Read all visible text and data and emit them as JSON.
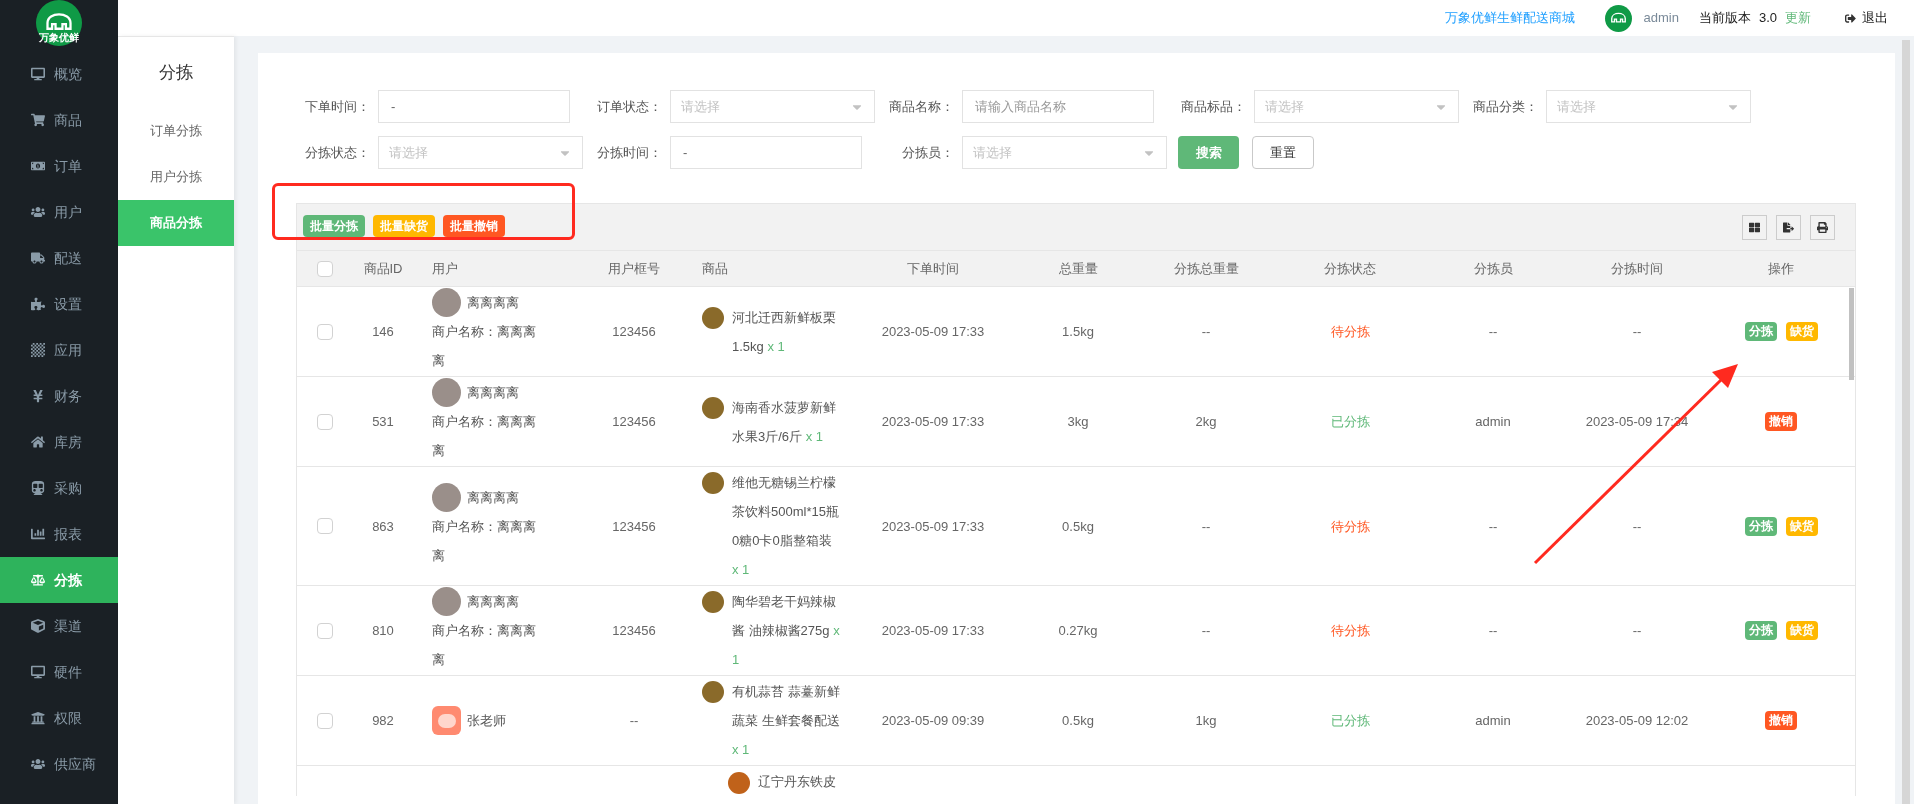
{
  "logo": {
    "text": "万象优鲜"
  },
  "top_bar": {
    "shop_link": "万象优鲜生鲜配送商城",
    "username": "admin",
    "version_label": "当前版本",
    "version": "3.0",
    "update": "更新",
    "logout": "退出"
  },
  "sidebar": {
    "items": [
      {
        "label": "概览",
        "selected": false
      },
      {
        "label": "商品",
        "selected": false
      },
      {
        "label": "订单",
        "selected": false
      },
      {
        "label": "用户",
        "selected": false
      },
      {
        "label": "配送",
        "selected": false
      },
      {
        "label": "设置",
        "selected": false
      },
      {
        "label": "应用",
        "selected": false
      },
      {
        "label": "财务",
        "selected": false
      },
      {
        "label": "库房",
        "selected": false
      },
      {
        "label": "采购",
        "selected": false
      },
      {
        "label": "报表",
        "selected": false
      },
      {
        "label": "分拣",
        "selected": true
      },
      {
        "label": "渠道",
        "selected": false
      },
      {
        "label": "硬件",
        "selected": false
      },
      {
        "label": "权限",
        "selected": false
      },
      {
        "label": "供应商",
        "selected": false
      }
    ]
  },
  "subnav": {
    "title": "分拣",
    "items": [
      {
        "label": "订单分拣",
        "selected": false
      },
      {
        "label": "用户分拣",
        "selected": false
      },
      {
        "label": "商品分拣",
        "selected": true
      }
    ]
  },
  "filters": [
    {
      "kind": "text",
      "label": "下单时间：",
      "value": "-"
    },
    {
      "kind": "select",
      "label": "订单状态：",
      "placeholder": "请选择"
    },
    {
      "kind": "text",
      "label": "商品名称：",
      "placeholder": "请输入商品名称"
    },
    {
      "kind": "select",
      "label": "商品标品：",
      "placeholder": "请选择"
    },
    {
      "kind": "select",
      "label": "商品分类：",
      "placeholder": "请选择"
    },
    {
      "kind": "select",
      "label": "分拣状态：",
      "placeholder": "请选择"
    },
    {
      "kind": "text",
      "label": "分拣时间：",
      "value": "-"
    },
    {
      "kind": "select",
      "label": "分拣员：",
      "placeholder": "请选择"
    }
  ],
  "search_button": "搜索",
  "reset_button": "重置",
  "batch_actions": [
    {
      "label": "批量分拣",
      "color": "#5fb878"
    },
    {
      "label": "批量缺货",
      "color": "#ffb800"
    },
    {
      "label": "批量撤销",
      "color": "#ff5722"
    }
  ],
  "table": {
    "all_checked": false,
    "columns": [
      "商品ID",
      "用户",
      "用户框号",
      "商品",
      "下单时间",
      "总重量",
      "分拣总重量",
      "分拣状态",
      "分拣员",
      "分拣时间",
      "操作"
    ],
    "rows": [
      {
        "checked": false,
        "id": "146",
        "user": {
          "kind": "photo",
          "name": "离离离离",
          "merchant": "商户名称：离离离离"
        },
        "box_no": "123456",
        "product": {
          "name": "河北迁西新鲜板栗1.5kg",
          "qty": "x 1"
        },
        "order_time": "2023-05-09 17:33",
        "total_weight": "1.5kg",
        "sorted_weight": "--",
        "status": {
          "kind": "pending",
          "label": "待分拣"
        },
        "sorter": "--",
        "sort_time": "--",
        "actions": [
          {
            "label": "分拣",
            "color": "#5fb878"
          },
          {
            "label": "缺货",
            "color": "#ffb800"
          }
        ]
      },
      {
        "checked": false,
        "id": "531",
        "user": {
          "kind": "photo",
          "name": "离离离离",
          "merchant": "商户名称：离离离离"
        },
        "box_no": "123456",
        "product": {
          "name": "海南香水菠萝新鲜水果3斤/6斤",
          "qty": "x 1"
        },
        "order_time": "2023-05-09 17:33",
        "total_weight": "3kg",
        "sorted_weight": "2kg",
        "status": {
          "kind": "done",
          "label": "已分拣"
        },
        "sorter": "admin",
        "sort_time": "2023-05-09 17:34",
        "actions": [
          {
            "label": "撤销",
            "color": "#ff5722"
          }
        ]
      },
      {
        "checked": false,
        "id": "863",
        "user": {
          "kind": "photo",
          "name": "离离离离",
          "merchant": "商户名称：离离离离"
        },
        "box_no": "123456",
        "product": {
          "name": "维他无糖锡兰柠檬茶饮料500ml*15瓶 0糖0卡0脂整箱装",
          "qty": "x 1"
        },
        "order_time": "2023-05-09 17:33",
        "total_weight": "0.5kg",
        "sorted_weight": "--",
        "status": {
          "kind": "pending",
          "label": "待分拣"
        },
        "sorter": "--",
        "sort_time": "--",
        "actions": [
          {
            "label": "分拣",
            "color": "#5fb878"
          },
          {
            "label": "缺货",
            "color": "#ffb800"
          }
        ]
      },
      {
        "checked": false,
        "id": "810",
        "user": {
          "kind": "photo",
          "name": "离离离离",
          "merchant": "商户名称：离离离离"
        },
        "box_no": "123456",
        "product": {
          "name": "陶华碧老干妈辣椒酱 油辣椒酱275g",
          "qty": "x 1"
        },
        "order_time": "2023-05-09 17:33",
        "total_weight": "0.27kg",
        "sorted_weight": "--",
        "status": {
          "kind": "pending",
          "label": "待分拣"
        },
        "sorter": "--",
        "sort_time": "--",
        "actions": [
          {
            "label": "分拣",
            "color": "#5fb878"
          },
          {
            "label": "缺货",
            "color": "#ffb800"
          }
        ]
      },
      {
        "checked": false,
        "id": "982",
        "user": {
          "kind": "pig",
          "name": "张老师"
        },
        "box_no": "--",
        "product": {
          "name": "有机蒜苔 蒜薹新鲜蔬菜 生鲜套餐配送",
          "qty": "x 1"
        },
        "order_time": "2023-05-09 09:39",
        "total_weight": "0.5kg",
        "sorted_weight": "1kg",
        "status": {
          "kind": "done",
          "label": "已分拣"
        },
        "sorter": "admin",
        "sort_time": "2023-05-09 12:02",
        "actions": [
          {
            "label": "撤销",
            "color": "#ff5722"
          }
        ]
      }
    ],
    "partial_row": {
      "product_name": "辽宁丹东铁皮"
    }
  }
}
